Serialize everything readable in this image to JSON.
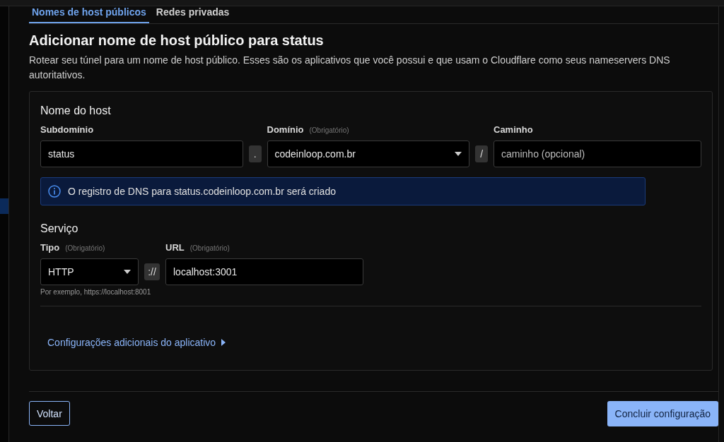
{
  "tabs": [
    {
      "label": "Nomes de host públicos",
      "selected": true
    },
    {
      "label": "Redes privadas",
      "selected": false
    }
  ],
  "title": "Adicionar nome de host público para status",
  "description": "Rotear seu túnel para um nome de host público. Esses são os aplicativos que você possui e que usam o Cloudflare como seus nameservers DNS autoritativos.",
  "hostname": {
    "heading": "Nome do host",
    "subdomain": {
      "label": "Subdomínio",
      "value": "status"
    },
    "dot": ".",
    "domain": {
      "label": "Domínio",
      "required": "(Obrigatório)",
      "value": "codeinloop.com.br"
    },
    "slash": "/",
    "path": {
      "label": "Caminho",
      "placeholder": "caminho (opcional)"
    },
    "info": "O registro de DNS para status.codeinloop.com.br será criado"
  },
  "service": {
    "heading": "Serviço",
    "type": {
      "label": "Tipo",
      "required": "(Obrigatório)",
      "value": "HTTP"
    },
    "separator": "://",
    "url": {
      "label": "URL",
      "required": "(Obrigatório)",
      "value": "localhost:3001"
    },
    "hint": "Por exemplo, https://localhost:8001"
  },
  "additional_settings": "Configurações adicionais do aplicativo",
  "buttons": {
    "back": "Voltar",
    "finish": "Concluir configuração"
  }
}
